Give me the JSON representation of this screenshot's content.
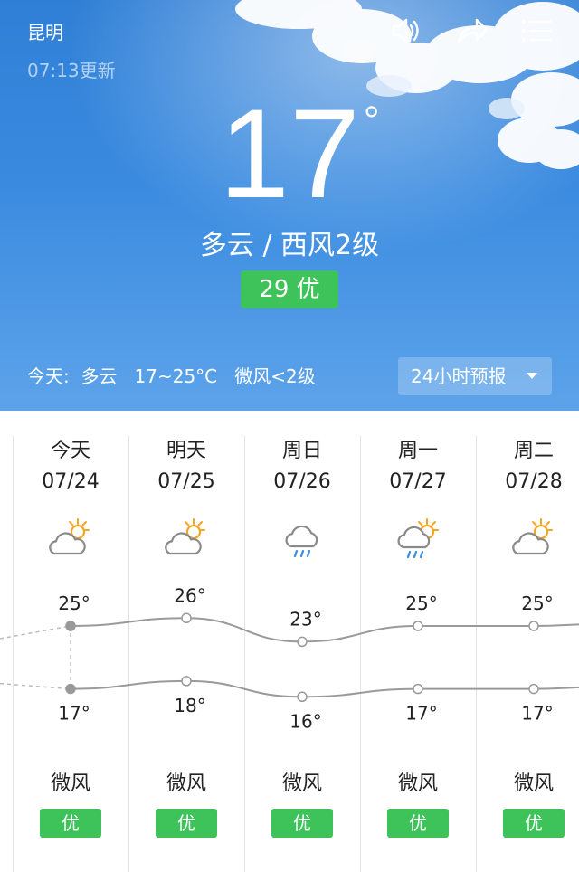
{
  "header": {
    "city": "昆明",
    "updated": "07:13更新",
    "icons": [
      "speaker-icon",
      "share-icon",
      "menu-icon"
    ]
  },
  "current": {
    "temperature": "17",
    "degree_symbol": "°",
    "condition": "多云 / 西风2级",
    "aqi": "29 优",
    "today_summary": "今天:  多云   17~25°C   微风<2级",
    "hourly_button": "24小时预报"
  },
  "colors": {
    "sky_top": "#2f7fd6",
    "aqi_good": "#3ec25a",
    "curve": "#9a9a9a"
  },
  "forecast": [
    {
      "day": "今天",
      "date": "07/24",
      "icon": "partly-cloudy-icon",
      "high": 25,
      "low": 17,
      "high_label": "25°",
      "low_label": "17°",
      "wind": "微风",
      "aqi": "优"
    },
    {
      "day": "明天",
      "date": "07/25",
      "icon": "partly-cloudy-icon",
      "high": 26,
      "low": 18,
      "high_label": "26°",
      "low_label": "18°",
      "wind": "微风",
      "aqi": "优"
    },
    {
      "day": "周日",
      "date": "07/26",
      "icon": "rain-icon",
      "high": 23,
      "low": 16,
      "high_label": "23°",
      "low_label": "16°",
      "wind": "微风",
      "aqi": "优"
    },
    {
      "day": "周一",
      "date": "07/27",
      "icon": "sun-rain-icon",
      "high": 25,
      "low": 17,
      "high_label": "25°",
      "low_label": "17°",
      "wind": "微风",
      "aqi": "优"
    },
    {
      "day": "周二",
      "date": "07/28",
      "icon": "partly-cloudy-icon",
      "high": 25,
      "low": 17,
      "high_label": "25°",
      "low_label": "17°",
      "wind": "微风",
      "aqi": "优"
    }
  ]
}
